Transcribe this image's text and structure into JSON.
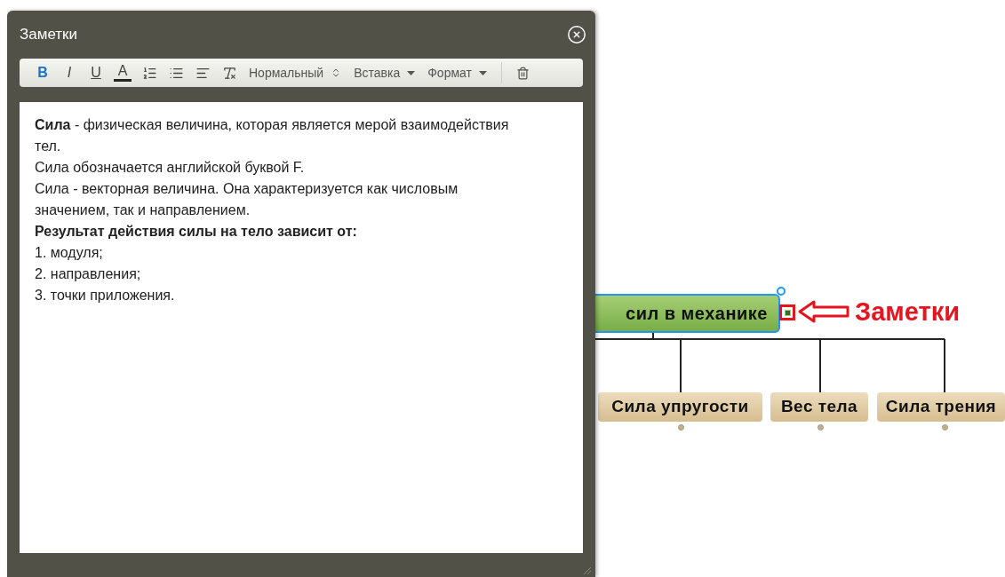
{
  "window": {
    "title": "Заметки"
  },
  "toolbar": {
    "format_buttons": [
      {
        "label": "B",
        "kind": "bold",
        "active": true
      },
      {
        "label": "I",
        "kind": "italic",
        "active": false
      },
      {
        "label": "U",
        "kind": "underline",
        "active": false
      },
      {
        "label": "A",
        "kind": "color",
        "active": false
      }
    ],
    "icon_buttons": [
      {
        "kind": "ordered-list"
      },
      {
        "kind": "bullet-list"
      },
      {
        "kind": "align"
      },
      {
        "kind": "clear-format"
      }
    ],
    "dropdowns": [
      {
        "label": "Нормальный",
        "kind": "updown"
      },
      {
        "label": "Вставка",
        "kind": "caret"
      },
      {
        "label": "Формат",
        "kind": "caret"
      }
    ]
  },
  "notes": [
    {
      "text": "**Сила** - физическая величина, которая является мерой взаимодействия тел.",
      "bold": false
    },
    {
      "text": "Сила обозначается английской буквой F.",
      "bold": false
    },
    {
      "text": "Сила - векторная величина. Она характеризуется как числовым значением, так и направлением.",
      "bold": false
    },
    {
      "text": "Результат действия силы на тело зависит от:",
      "bold": true
    },
    {
      "text": "1. модуля;",
      "bold": false
    },
    {
      "text": "2. направления;",
      "bold": false
    },
    {
      "text": "3. точки приложения.",
      "bold": false
    }
  ],
  "mindmap": {
    "central": {
      "label": "сил в механике",
      "selected": true,
      "has_note": true
    },
    "children": [
      {
        "label": "Сила упругости"
      },
      {
        "label": "Вес тела"
      },
      {
        "label": "Сила трения"
      }
    ],
    "annotation": "Заметки"
  }
}
